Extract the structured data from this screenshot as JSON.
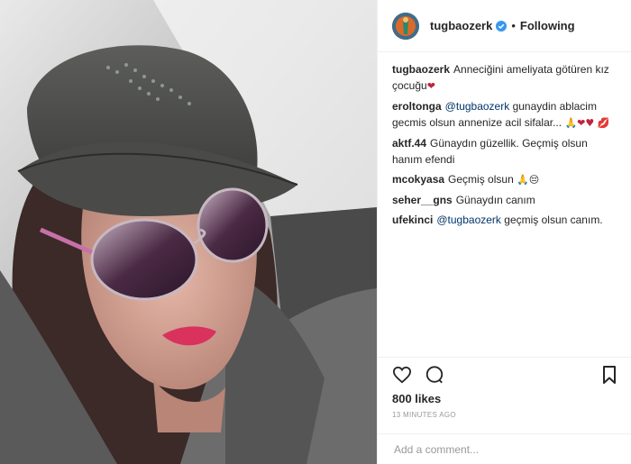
{
  "post": {
    "username": "tugbaozerk",
    "follow_status": "Following",
    "separator": "•",
    "likes": "800 likes",
    "timestamp": "13 minutes ago",
    "add_comment_placeholder": "Add a comment..."
  },
  "icons": {
    "verified": "verified-badge-icon",
    "like": "heart-icon",
    "comment": "comment-icon",
    "save": "bookmark-icon"
  },
  "colors": {
    "verified_blue": "#3897f0",
    "mention": "#003569",
    "heart_red": "#c0233d"
  },
  "comments": [
    {
      "user": "tugbaozerk",
      "text": "Anneciğini ameliyata götüren kız çocuğu",
      "emoji": "❤"
    },
    {
      "user": "eroltonga",
      "mention": "@tugbaozerk",
      "text": "gunaydin ablacim gecmis olsun annenize acil sifalar...",
      "emoji": "🙏❤♥ 💋"
    },
    {
      "user": "aktf.44",
      "text": "Günaydın güzellik. Geçmiş olsun hanım efendi",
      "emoji": ""
    },
    {
      "user": "mcokyasa",
      "text": "Geçmiş olsun",
      "emoji": "🙏😔"
    },
    {
      "user": "seher__gns",
      "text": "Günaydın canım",
      "emoji": ""
    },
    {
      "user": "ufekinci",
      "mention": "@tugbaozerk",
      "text": "geçmiş olsun canım.",
      "emoji": ""
    }
  ]
}
